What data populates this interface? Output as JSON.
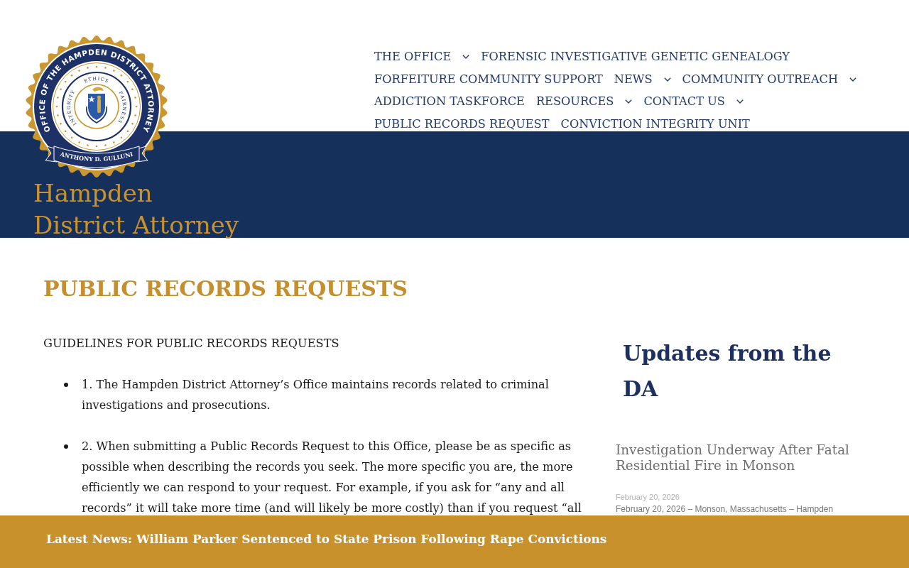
{
  "header": {
    "logo": {
      "ring_text": "OFFICE OF THE HAMPDEN DISTRICT ATTORNEY",
      "mottos": {
        "top": "ETHICS",
        "left": "INTEGRITY",
        "right": "FAIRNESS"
      },
      "banner_text": "ANTHONY D. GULLUNI"
    },
    "site_title": [
      "Hampden",
      "District Attorney"
    ],
    "nav": {
      "items": [
        {
          "label": "THE OFFICE",
          "has_submenu": true
        },
        {
          "label": "FORENSIC INVESTIGATIVE GENETIC GENEALOGY",
          "has_submenu": false
        },
        {
          "label": "FORFEITURE COMMUNITY SUPPORT",
          "has_submenu": false
        },
        {
          "label": "NEWS",
          "has_submenu": true
        },
        {
          "label": "COMMUNITY OUTREACH",
          "has_submenu": true
        },
        {
          "label": "ADDICTION TASKFORCE",
          "has_submenu": false
        },
        {
          "label": "RESOURCES",
          "has_submenu": true
        },
        {
          "label": "CONTACT US",
          "has_submenu": true
        },
        {
          "label": "PUBLIC RECORDS REQUEST",
          "has_submenu": false
        },
        {
          "label": "CONVICTION INTEGRITY UNIT",
          "has_submenu": false
        }
      ]
    }
  },
  "page": {
    "title": "PUBLIC RECORDS REQUESTS",
    "subtitle": "GUIDELINES FOR PUBLIC RECORDS REQUESTS",
    "list_items": [
      "1. The Hampden District Attorney’s Office maintains records related to criminal investigations and prosecutions.",
      "2. When submitting a Public Records Request to this Office, please be as specific as possible when describing the records you seek. The more specific you are, the more efficiently we can respond to your request. For example, if you ask for “any and all records” it will take more time (and will likely be more costly) than if you request “all"
    ]
  },
  "sidebar": {
    "heading": "Updates from the DA",
    "posts": [
      {
        "title": "Investigation Underway After Fatal Residential Fire in Monson",
        "date": "February 20, 2026",
        "excerpt": "February 20, 2026 – Monson, Massachusetts – Hampden"
      }
    ]
  },
  "latest_news_bar": {
    "text": "Latest News: William Parker Sentenced to State Prison Following Rape Convictions"
  }
}
